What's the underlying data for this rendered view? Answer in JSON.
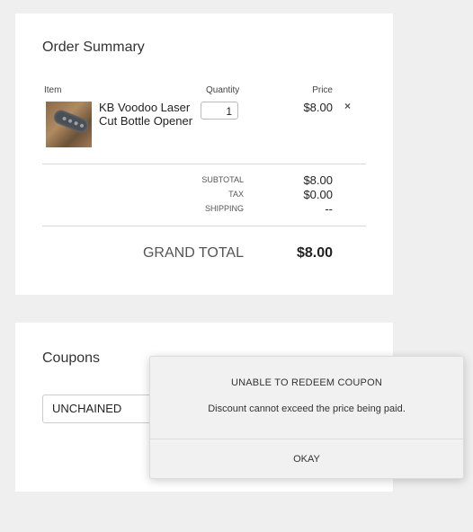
{
  "order_summary": {
    "title": "Order Summary",
    "columns": {
      "item": "Item",
      "quantity": "Quantity",
      "price": "Price"
    },
    "items": [
      {
        "name": "KB Voodoo Laser Cut Bottle Opener",
        "quantity": "1",
        "price": "$8.00",
        "remove_icon": "×"
      }
    ],
    "subtotal_label": "SUBTOTAL",
    "subtotal_value": "$8.00",
    "tax_label": "TAX",
    "tax_value": "$0.00",
    "shipping_label": "SHIPPING",
    "shipping_value": "--",
    "grand_total_label": "GRAND TOTAL",
    "grand_total_value": "$8.00"
  },
  "coupons": {
    "title": "Coupons",
    "input_value": "UNCHAINED"
  },
  "modal": {
    "title": "UNABLE TO REDEEM COUPON",
    "message": "Discount cannot exceed the price being paid.",
    "button": "OKAY"
  }
}
